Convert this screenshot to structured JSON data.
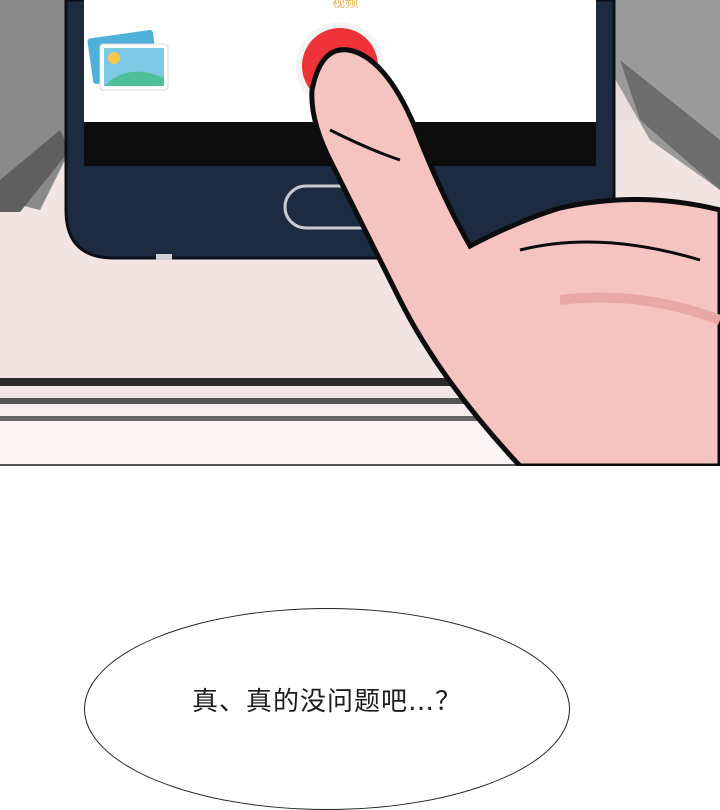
{
  "camera_screen": {
    "mode_label": "视频",
    "icons": {
      "gallery": "gallery-thumbnail-icon",
      "shutter": "record-button-icon",
      "home": "home-button-icon"
    },
    "colors": {
      "record_button": "#ee3338",
      "phone_body": "#1c2b40",
      "screen_bg": "#ffffff"
    }
  },
  "dialogue": {
    "bubble_text": "真、真的没问题吧…？"
  }
}
